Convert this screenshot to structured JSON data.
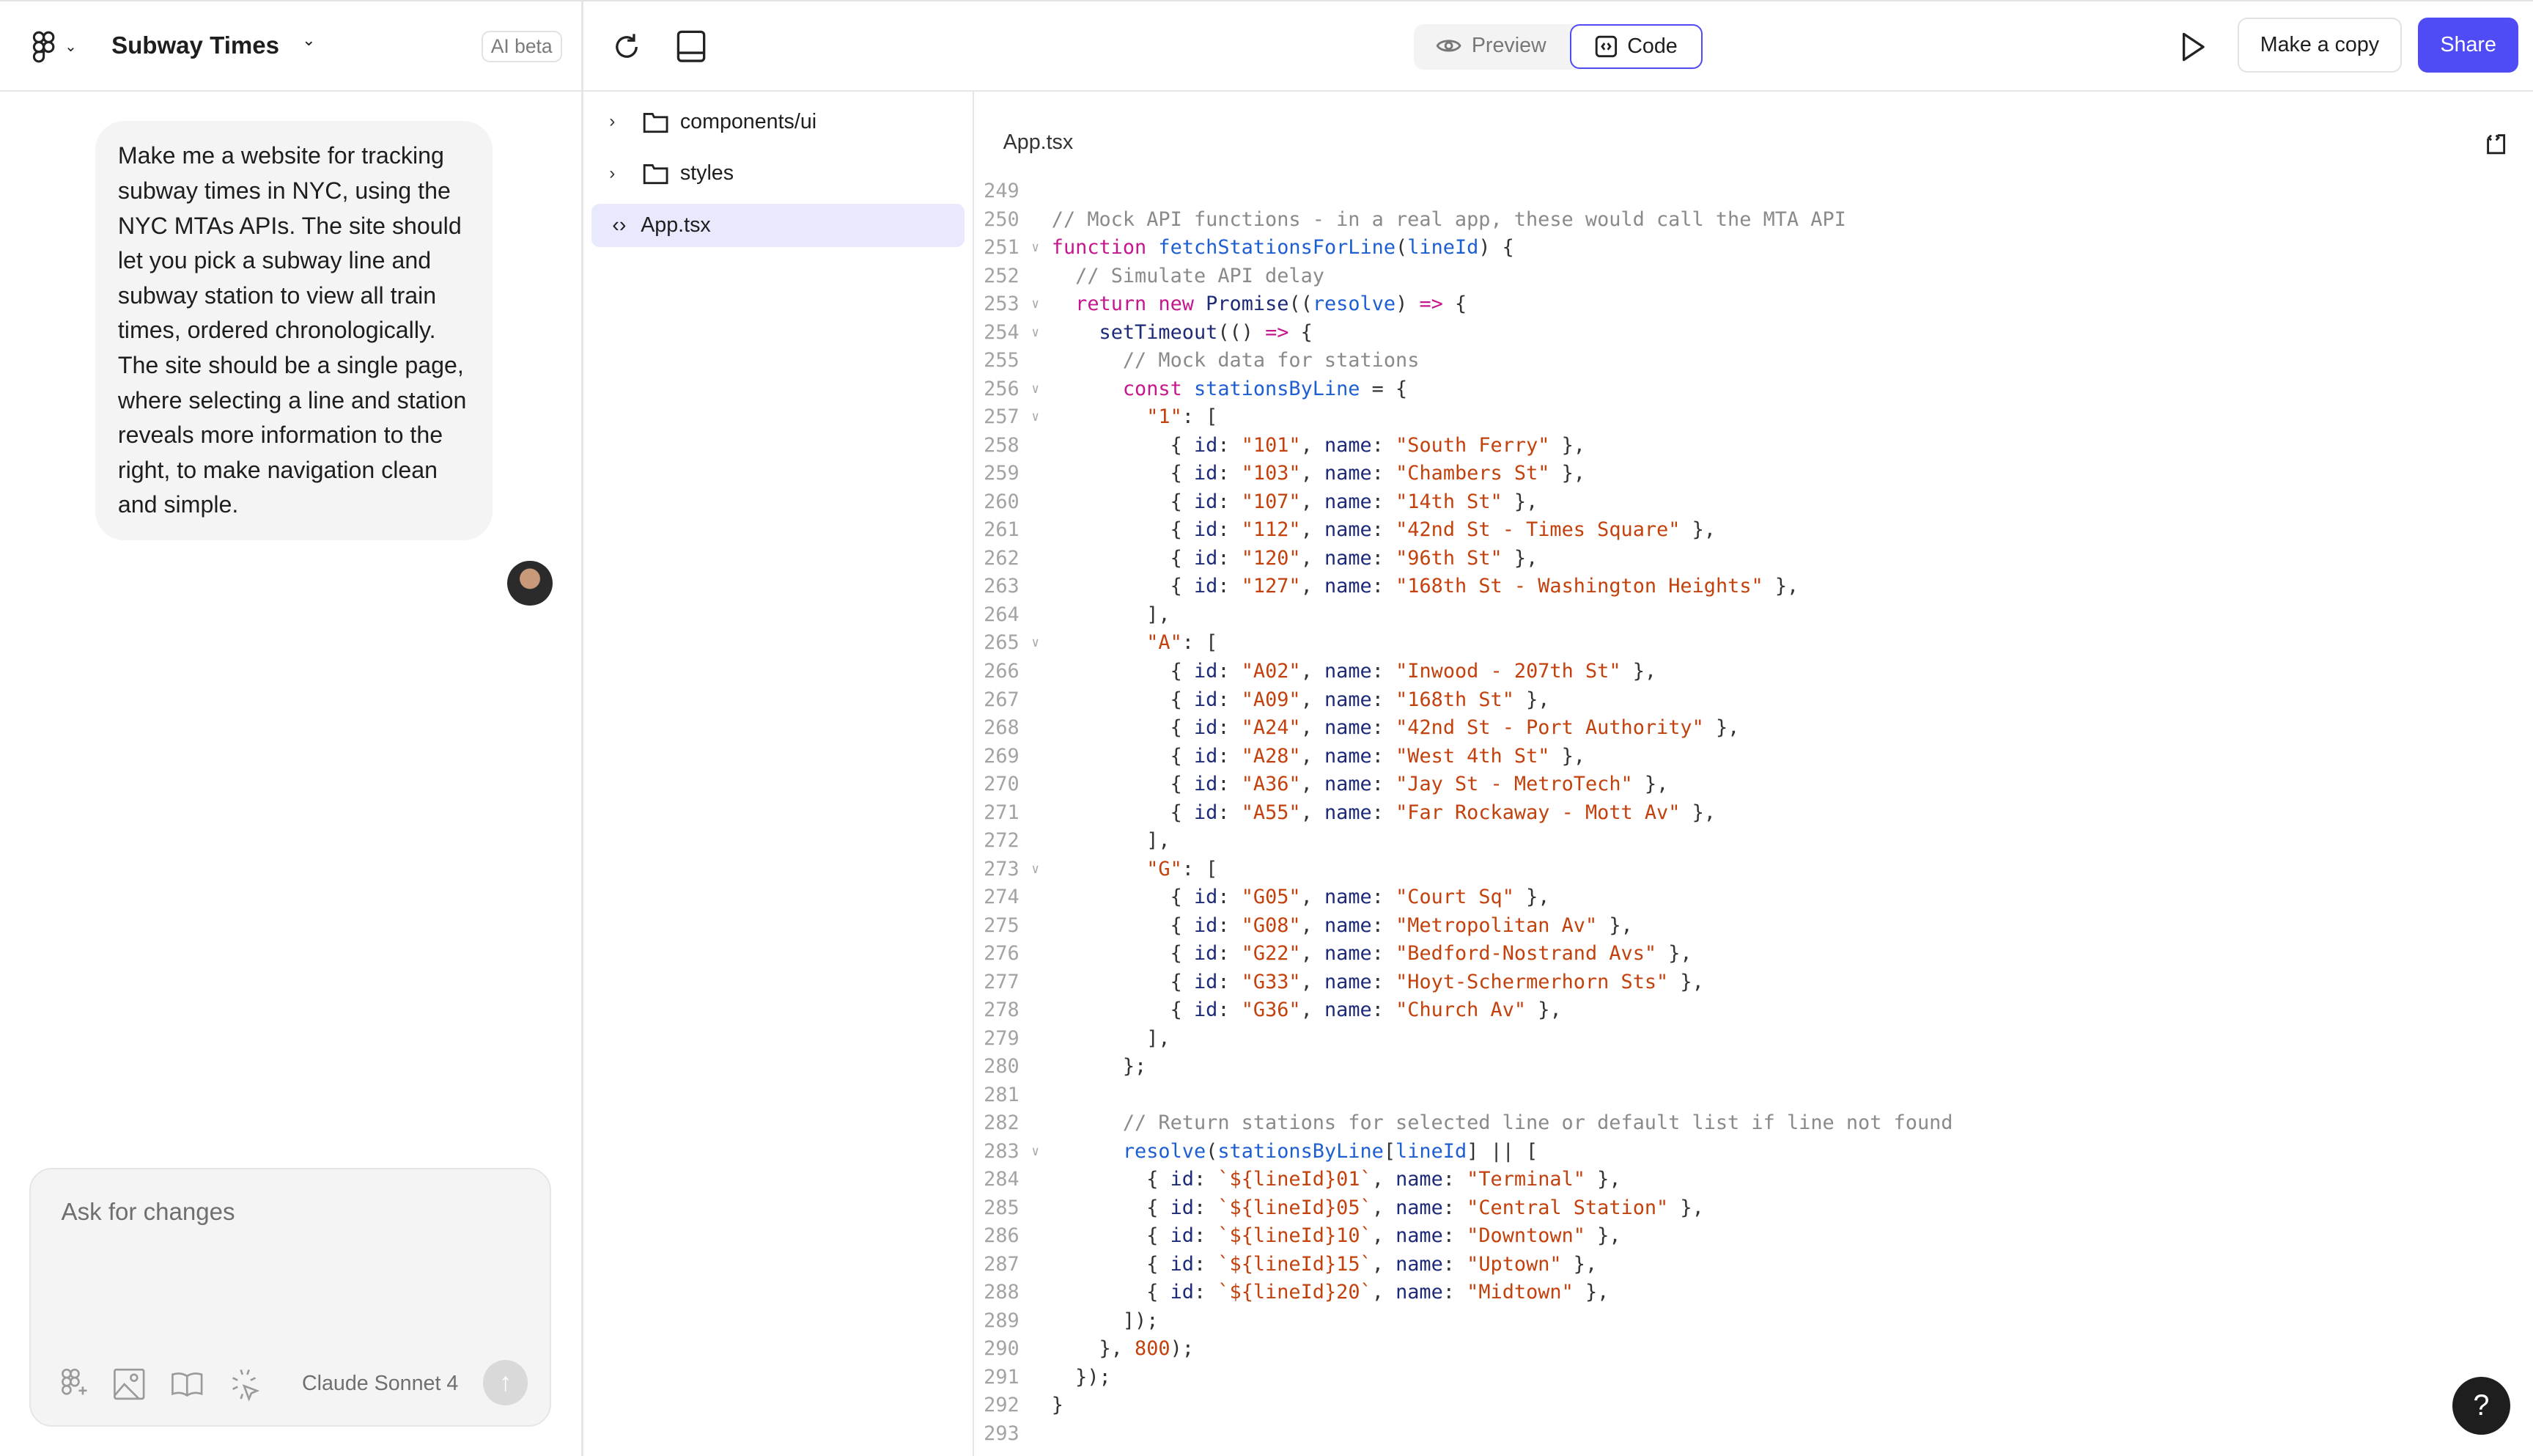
{
  "header": {
    "project_title": "Subway Times",
    "ai_badge": "AI beta",
    "preview_label": "Preview",
    "code_label": "Code",
    "make_copy_label": "Make a copy",
    "share_label": "Share",
    "accent_color": "#4f4cf5"
  },
  "chat": {
    "user_message": "Make me a website for tracking subway times in NYC, using the NYC MTAs APIs. The site should let you pick a subway line and subway station to view all train times, ordered chronologically. The site should be a single page, where selecting a line and station reveals more information to the right, to make navigation clean and simple.",
    "composer_placeholder": "Ask for changes",
    "model_name": "Claude Sonnet 4"
  },
  "file_tree": [
    {
      "label": "components/ui",
      "type": "folder"
    },
    {
      "label": "styles",
      "type": "folder"
    },
    {
      "label": "App.tsx",
      "type": "file",
      "selected": true
    }
  ],
  "editor": {
    "file_name": "App.tsx",
    "lines": [
      {
        "n": "249",
        "fold": false,
        "text": ""
      },
      {
        "n": "250",
        "fold": false,
        "text": "// Mock API functions - in a real app, these would call the MTA API"
      },
      {
        "n": "251",
        "fold": true,
        "text": "function fetchStationsForLine(lineId) {"
      },
      {
        "n": "252",
        "fold": false,
        "text": "  // Simulate API delay"
      },
      {
        "n": "253",
        "fold": true,
        "text": "  return new Promise((resolve) => {"
      },
      {
        "n": "254",
        "fold": true,
        "text": "    setTimeout(() => {"
      },
      {
        "n": "255",
        "fold": false,
        "text": "      // Mock data for stations"
      },
      {
        "n": "256",
        "fold": true,
        "text": "      const stationsByLine = {"
      },
      {
        "n": "257",
        "fold": true,
        "text": "        \"1\": ["
      },
      {
        "n": "258",
        "fold": false,
        "text": "          { id: \"101\", name: \"South Ferry\" },"
      },
      {
        "n": "259",
        "fold": false,
        "text": "          { id: \"103\", name: \"Chambers St\" },"
      },
      {
        "n": "260",
        "fold": false,
        "text": "          { id: \"107\", name: \"14th St\" },"
      },
      {
        "n": "261",
        "fold": false,
        "text": "          { id: \"112\", name: \"42nd St - Times Square\" },"
      },
      {
        "n": "262",
        "fold": false,
        "text": "          { id: \"120\", name: \"96th St\" },"
      },
      {
        "n": "263",
        "fold": false,
        "text": "          { id: \"127\", name: \"168th St - Washington Heights\" },"
      },
      {
        "n": "264",
        "fold": false,
        "text": "        ],"
      },
      {
        "n": "265",
        "fold": true,
        "text": "        \"A\": ["
      },
      {
        "n": "266",
        "fold": false,
        "text": "          { id: \"A02\", name: \"Inwood - 207th St\" },"
      },
      {
        "n": "267",
        "fold": false,
        "text": "          { id: \"A09\", name: \"168th St\" },"
      },
      {
        "n": "268",
        "fold": false,
        "text": "          { id: \"A24\", name: \"42nd St - Port Authority\" },"
      },
      {
        "n": "269",
        "fold": false,
        "text": "          { id: \"A28\", name: \"West 4th St\" },"
      },
      {
        "n": "270",
        "fold": false,
        "text": "          { id: \"A36\", name: \"Jay St - MetroTech\" },"
      },
      {
        "n": "271",
        "fold": false,
        "text": "          { id: \"A55\", name: \"Far Rockaway - Mott Av\" },"
      },
      {
        "n": "272",
        "fold": false,
        "text": "        ],"
      },
      {
        "n": "273",
        "fold": true,
        "text": "        \"G\": ["
      },
      {
        "n": "274",
        "fold": false,
        "text": "          { id: \"G05\", name: \"Court Sq\" },"
      },
      {
        "n": "275",
        "fold": false,
        "text": "          { id: \"G08\", name: \"Metropolitan Av\" },"
      },
      {
        "n": "276",
        "fold": false,
        "text": "          { id: \"G22\", name: \"Bedford-Nostrand Avs\" },"
      },
      {
        "n": "277",
        "fold": false,
        "text": "          { id: \"G33\", name: \"Hoyt-Schermerhorn Sts\" },"
      },
      {
        "n": "278",
        "fold": false,
        "text": "          { id: \"G36\", name: \"Church Av\" },"
      },
      {
        "n": "279",
        "fold": false,
        "text": "        ],"
      },
      {
        "n": "280",
        "fold": false,
        "text": "      };"
      },
      {
        "n": "281",
        "fold": false,
        "text": ""
      },
      {
        "n": "282",
        "fold": false,
        "text": "      // Return stations for selected line or default list if line not found"
      },
      {
        "n": "283",
        "fold": true,
        "text": "      resolve(stationsByLine[lineId] || ["
      },
      {
        "n": "284",
        "fold": false,
        "text": "        { id: `${lineId}01`, name: \"Terminal\" },"
      },
      {
        "n": "285",
        "fold": false,
        "text": "        { id: `${lineId}05`, name: \"Central Station\" },"
      },
      {
        "n": "286",
        "fold": false,
        "text": "        { id: `${lineId}10`, name: \"Downtown\" },"
      },
      {
        "n": "287",
        "fold": false,
        "text": "        { id: `${lineId}15`, name: \"Uptown\" },"
      },
      {
        "n": "288",
        "fold": false,
        "text": "        { id: `${lineId}20`, name: \"Midtown\" },"
      },
      {
        "n": "289",
        "fold": false,
        "text": "      ]);"
      },
      {
        "n": "290",
        "fold": false,
        "text": "    }, 800);"
      },
      {
        "n": "291",
        "fold": false,
        "text": "  });"
      },
      {
        "n": "292",
        "fold": false,
        "text": "}"
      },
      {
        "n": "293",
        "fold": false,
        "text": ""
      }
    ]
  },
  "help_label": "?"
}
